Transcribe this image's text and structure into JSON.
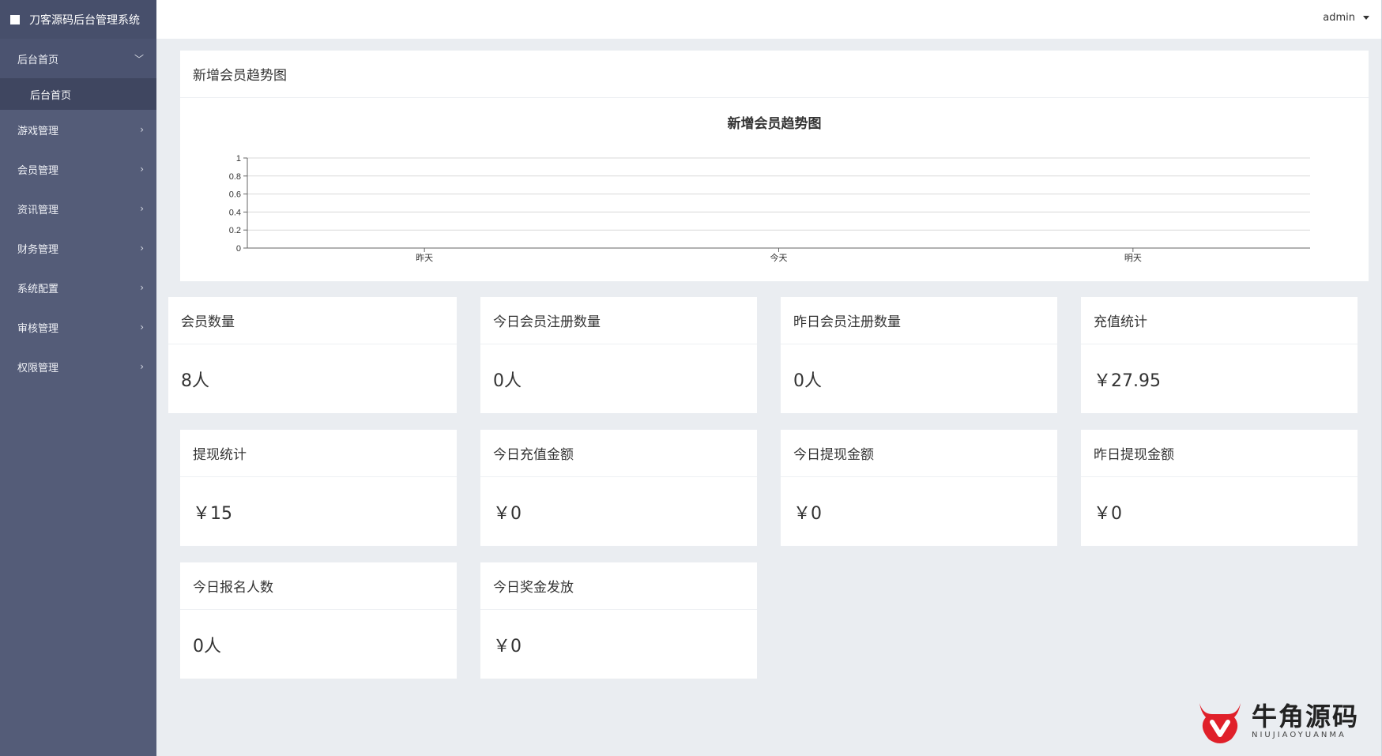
{
  "app": {
    "title": "刀客源码后台管理系统"
  },
  "header": {
    "user": "admin"
  },
  "sidebar": {
    "items": [
      {
        "label": "后台首页",
        "open": true,
        "children": [
          {
            "label": "后台首页"
          }
        ]
      },
      {
        "label": "游戏管理"
      },
      {
        "label": "会员管理"
      },
      {
        "label": "资讯管理"
      },
      {
        "label": "财务管理"
      },
      {
        "label": "系统配置"
      },
      {
        "label": "审核管理"
      },
      {
        "label": "权限管理"
      }
    ]
  },
  "chart_panel": {
    "title": "新增会员趋势图"
  },
  "chart_data": {
    "type": "line",
    "title": "新增会员趋势图",
    "categories": [
      "昨天",
      "今天",
      "明天"
    ],
    "series": [
      {
        "values": [
          0,
          0,
          0
        ]
      }
    ],
    "ylim": [
      0,
      1
    ],
    "yticks": [
      "1",
      "0.8",
      "0.6",
      "0.4",
      "0.2",
      "0"
    ],
    "grid": true,
    "xlabel": "",
    "ylabel": ""
  },
  "stats": [
    {
      "title": "会员数量",
      "value": "8人"
    },
    {
      "title": "今日会员注册数量",
      "value": "0人"
    },
    {
      "title": "昨日会员注册数量",
      "value": "0人"
    },
    {
      "title": "充值统计",
      "value": "￥27.95"
    },
    {
      "title": "提现统计",
      "value": "￥15"
    },
    {
      "title": "今日充值金额",
      "value": "￥0"
    },
    {
      "title": "今日提现金额",
      "value": "￥0"
    },
    {
      "title": "昨日提现金额",
      "value": "￥0"
    },
    {
      "title": "今日报名人数",
      "value": "0人"
    },
    {
      "title": "今日奖金发放",
      "value": "￥0"
    }
  ],
  "watermark": {
    "name": "牛角源码",
    "sub": "NIUJIAOYUANMA",
    "color": "#e0202a"
  }
}
